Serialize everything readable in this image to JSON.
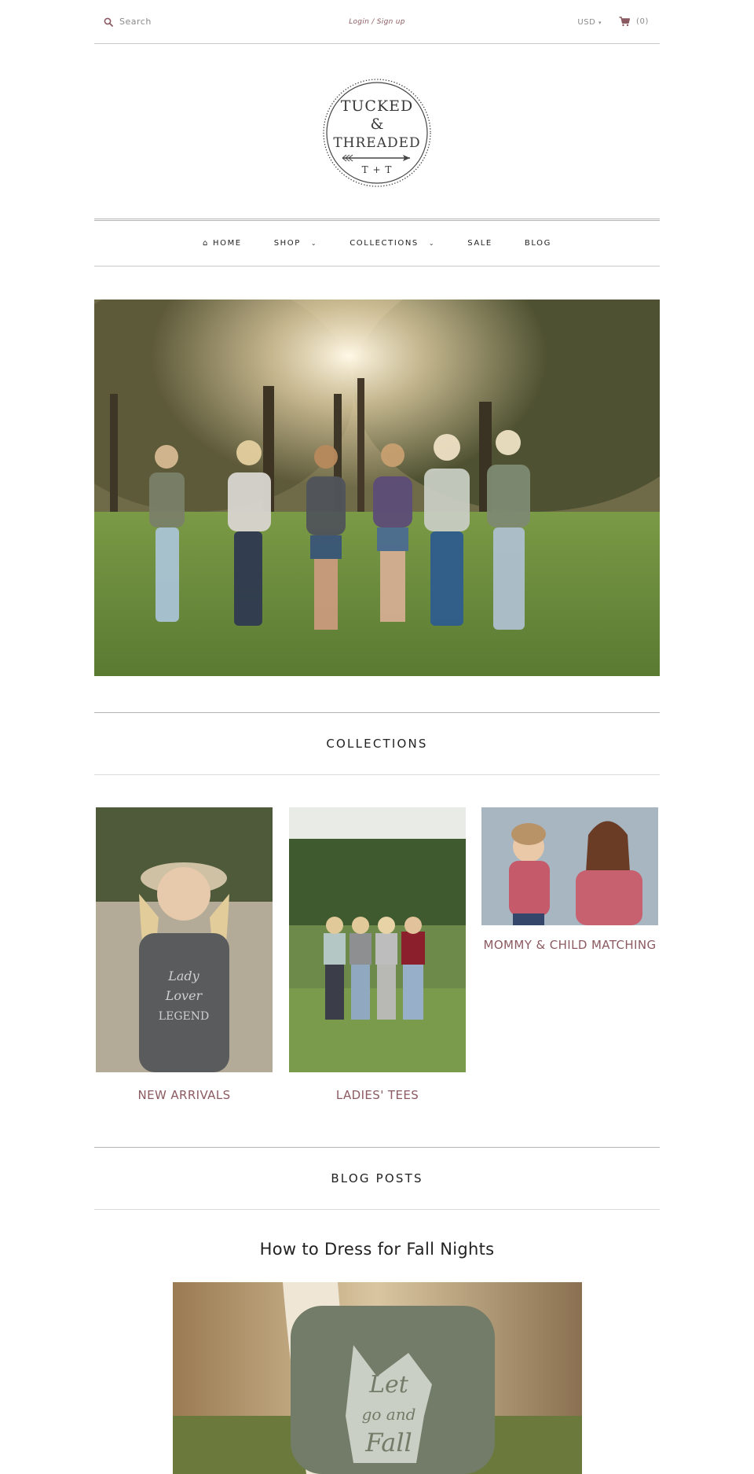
{
  "topbar": {
    "search_placeholder": "Search",
    "login_link": "Login / Sign up",
    "currency": "USD",
    "cart_count": "(0)"
  },
  "brand": {
    "logo_lines": [
      "TUCKED",
      "&",
      "THREADED",
      "T + T"
    ]
  },
  "nav": {
    "items": [
      {
        "label": "HOME",
        "icon": "home-icon"
      },
      {
        "label": "SHOP",
        "dropdown": true
      },
      {
        "label": "COLLECTIONS",
        "dropdown": true
      },
      {
        "label": "SALE"
      },
      {
        "label": "BLOG"
      }
    ]
  },
  "collections": {
    "heading": "COLLECTIONS",
    "items": [
      {
        "label": "NEW ARRIVALS"
      },
      {
        "label": "LADIES' TEES"
      },
      {
        "label": "MOMMY & CHILD MATCHING"
      }
    ]
  },
  "blog": {
    "heading": "BLOG POSTS",
    "post_title": "How to Dress for Fall Nights"
  },
  "colors": {
    "accent": "#8b5a61",
    "text": "#222222",
    "rule": "#c9c9c9"
  }
}
